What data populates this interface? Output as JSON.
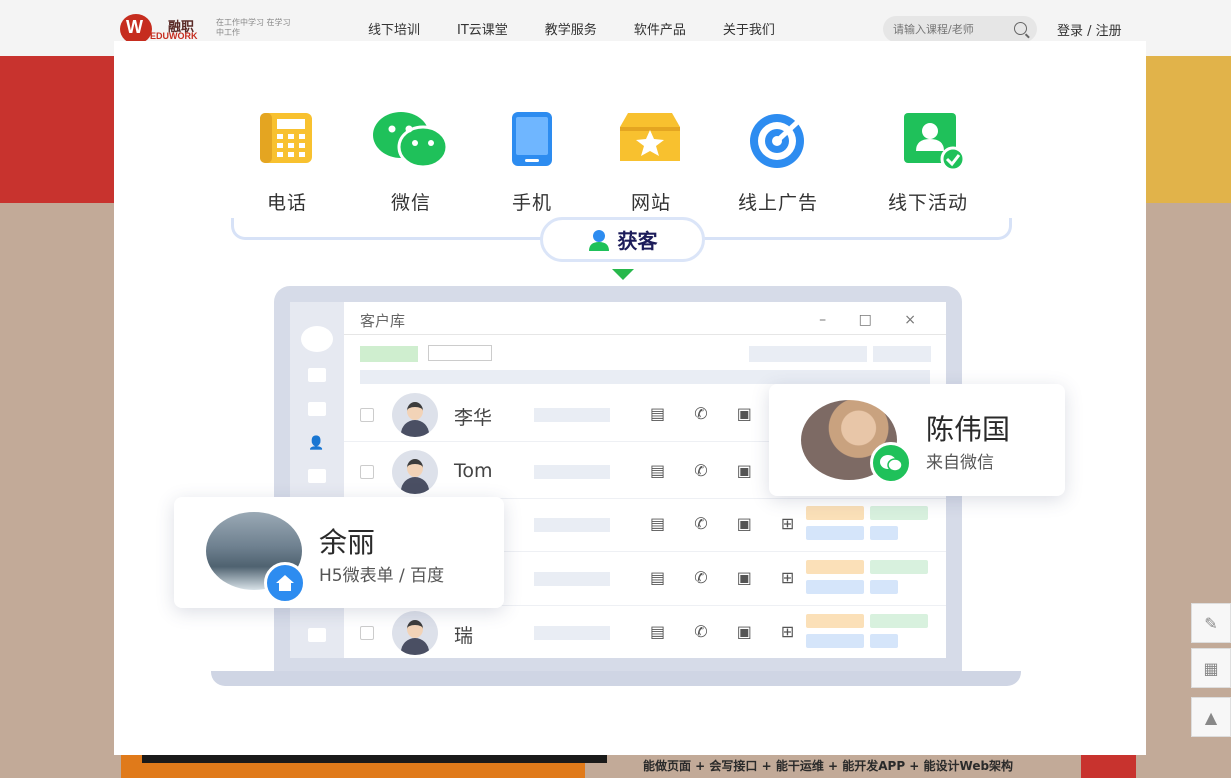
{
  "header": {
    "logo_cn": "融职",
    "logo_en": "EDUWORK",
    "logo_slogan": "在工作中学习 在学习中工作",
    "nav": [
      "线下培训",
      "IT云课堂",
      "教学服务",
      "软件产品",
      "关于我们"
    ],
    "search_placeholder": "请输入课程/老师",
    "login": "登录 / 注册"
  },
  "background": {
    "footer_text": "能做页面 + 会写接口 + 能干运维 + 能开发APP + 能设计Web架构"
  },
  "modal": {
    "channels": [
      {
        "label": "电话",
        "icon": "phone-icon"
      },
      {
        "label": "微信",
        "icon": "wechat-icon"
      },
      {
        "label": "手机",
        "icon": "mobile-icon"
      },
      {
        "label": "网站",
        "icon": "website-icon"
      },
      {
        "label": "线上广告",
        "icon": "online-ad-icon"
      },
      {
        "label": "线下活动",
        "icon": "offline-event-icon"
      }
    ],
    "acquire_label": "获客",
    "window_title": "客户库",
    "window_controls": "– □ ×",
    "rows": [
      {
        "name": "李华"
      },
      {
        "name": "Tom"
      },
      {
        "name": ""
      },
      {
        "name": ""
      },
      {
        "name": "瑞"
      }
    ],
    "row_icons": "▤ ✆ ▣ ⊞",
    "card_right": {
      "name": "陈伟国",
      "source": "来自微信"
    },
    "card_left": {
      "name": "余丽",
      "source": "H5微表单 / 百度"
    }
  },
  "colors": {
    "brand_red": "#c62d1f",
    "accent_blue": "#2d8cf0",
    "accent_green": "#1fc15a",
    "accent_yellow": "#f8c12f"
  }
}
